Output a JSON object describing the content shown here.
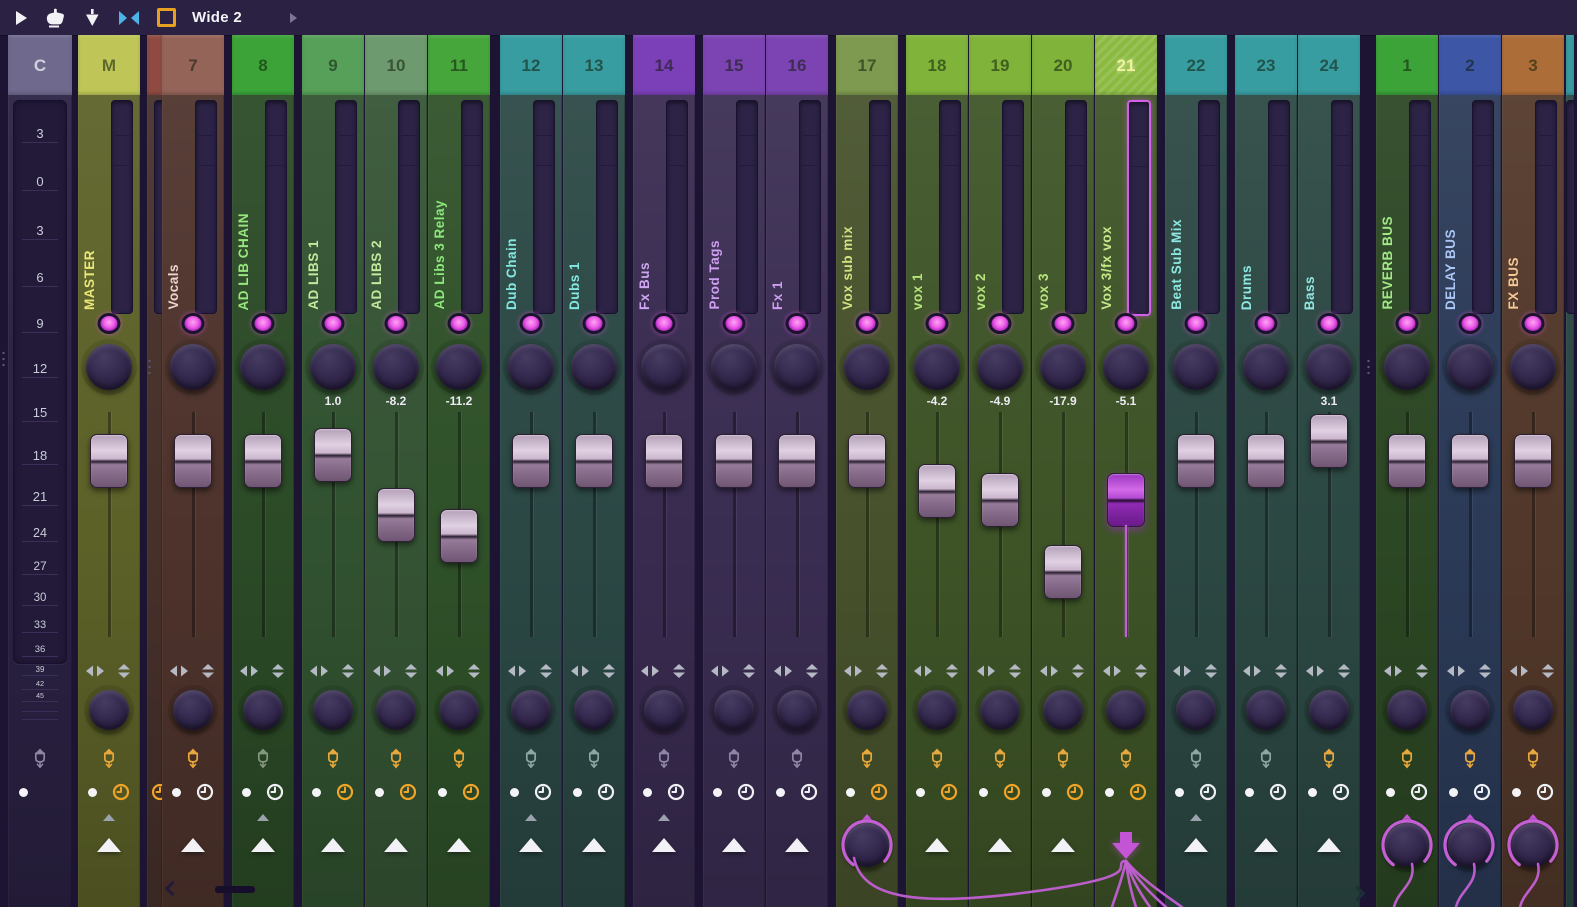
{
  "topbar": {
    "layout_label": "Wide 2",
    "icons": [
      "play-arrow-icon",
      "hand-cursor-icon",
      "plumb-bob-icon",
      "mirror-triangles-icon",
      "orange-square-icon",
      "chevron-right-icon"
    ],
    "accent_orange": "#e8a020",
    "accent_blue": "#4db4e8"
  },
  "scale_strip": {
    "header": "C",
    "labels": [
      "3",
      "0",
      "3",
      "6",
      "9",
      "12",
      "15",
      "18",
      "21",
      "24",
      "27",
      "30",
      "33",
      "36",
      "39",
      "42",
      "45"
    ],
    "lamp_color": "#8d87a4",
    "record_dot": true,
    "header_color": "#6f6a8d",
    "body_color": "#2a2142"
  },
  "colors": {
    "led": "#ea5ae6",
    "cable": "#c45fd6",
    "clock_orange": "#f0a428",
    "clock_white": "#eef0f4",
    "lamp_orange": "#e9a83c",
    "selected_outline": "#d45fe8"
  },
  "selection": {
    "selected_strip": "21"
  },
  "strips": [
    {
      "type": "strip",
      "number": "M",
      "name": "MASTER",
      "db": "",
      "fader": 0.13,
      "header": "#bfc657",
      "body": "#5c6128",
      "name_color": "#e9e977",
      "lamp": "#e9a83c",
      "clock": "#f0a428",
      "small_arrow": "#9aa2ad",
      "bottom": "triangle",
      "selected": false
    },
    {
      "type": "sliver",
      "number": "",
      "name": "",
      "header": "#8f4b41",
      "body": "#46302a",
      "clock": "#f0a428"
    },
    {
      "type": "strip",
      "number": "7",
      "name": "Vocals",
      "db": "",
      "fader": 0.13,
      "header": "#956459",
      "body": "#4e332c",
      "name_color": "#ecd3cb",
      "lamp": "#e9a83c",
      "clock": "#eef0f4",
      "small_arrow": null,
      "bottom": "triangle",
      "selected": false
    },
    {
      "type": "strip",
      "number": "8",
      "name": "AD LIB CHAIN",
      "db": "",
      "fader": 0.13,
      "header": "#3ba338",
      "body": "#2b4a26",
      "name_color": "#97e67e",
      "lamp": "#84977f",
      "clock": "#eef0f4",
      "small_arrow": "#9aa2ad",
      "bottom": "triangle",
      "selected": false
    },
    {
      "type": "strip",
      "number": "9",
      "name": "AD LIBS 1",
      "db": "1.0",
      "fader": 0.09,
      "header": "#57a059",
      "body": "#315230",
      "name_color": "#c4e89e",
      "lamp": "#e9a83c",
      "clock": "#f0a428",
      "small_arrow": null,
      "bottom": "triangle",
      "selected": false
    },
    {
      "type": "strip",
      "number": "10",
      "name": "AD LIBS 2",
      "db": "-8.2",
      "fader": 0.44,
      "header": "#6d9a6e",
      "body": "#355434",
      "name_color": "#c4e89e",
      "lamp": "#e9a83c",
      "clock": "#f0a428",
      "small_arrow": null,
      "bottom": "triangle",
      "selected": false
    },
    {
      "type": "strip",
      "number": "11",
      "name": "AD Libs 3 Relay",
      "db": "-11.2",
      "fader": 0.56,
      "header": "#46a63c",
      "body": "#2f5129",
      "name_color": "#8ce87a",
      "lamp": "#e9a83c",
      "clock": "#f0a428",
      "small_arrow": null,
      "bottom": "triangle",
      "selected": false
    },
    {
      "type": "strip",
      "number": "12",
      "name": "Dub Chain",
      "db": "",
      "fader": 0.13,
      "header": "#389da1",
      "body": "#2b4845",
      "name_color": "#83e8df",
      "lamp": "#8fa7a4",
      "clock": "#eef0f4",
      "small_arrow": "#9aa2ad",
      "bottom": "triangle",
      "selected": false
    },
    {
      "type": "strip",
      "number": "13",
      "name": "Dubs 1",
      "db": "",
      "fader": 0.13,
      "header": "#389da1",
      "body": "#2b4845",
      "name_color": "#83e8df",
      "lamp": "#8fa7a4",
      "clock": "#eef0f4",
      "small_arrow": null,
      "bottom": "triangle",
      "selected": false
    },
    {
      "type": "strip",
      "number": "14",
      "name": "Fx Bus",
      "db": "",
      "fader": 0.13,
      "header": "#7b3fb8",
      "body": "#392b50",
      "name_color": "#cda6f2",
      "lamp": "#8f86a8",
      "clock": "#eef0f4",
      "small_arrow": "#9aa2ad",
      "bottom": "triangle",
      "selected": false
    },
    {
      "type": "strip",
      "number": "15",
      "name": "Prod Tags",
      "db": "",
      "fader": 0.13,
      "header": "#7b44b2",
      "body": "#3a2d52",
      "name_color": "#cf9ef0",
      "lamp": "#8f86a8",
      "clock": "#eef0f4",
      "small_arrow": null,
      "bottom": "triangle",
      "selected": false
    },
    {
      "type": "strip",
      "number": "16",
      "name": "Fx 1",
      "db": "",
      "fader": 0.13,
      "header": "#7b44b2",
      "body": "#3a2d52",
      "name_color": "#cf9ef0",
      "lamp": "#8f86a8",
      "clock": "#eef0f4",
      "small_arrow": null,
      "bottom": "triangle",
      "selected": false
    },
    {
      "type": "strip",
      "number": "17",
      "name": "Vox sub mix",
      "db": "",
      "fader": 0.13,
      "header": "#7e9a50",
      "body": "#47522c",
      "name_color": "#cfe381",
      "lamp": "#e9a83c",
      "clock": "#f0a428",
      "small_arrow": "#c355d6",
      "bottom": "send-knob",
      "selected": false
    },
    {
      "type": "strip",
      "number": "18",
      "name": "vox 1",
      "db": "-4.2",
      "fader": 0.3,
      "header": "#7fb33a",
      "body": "#3e5427",
      "name_color": "#b6e47c",
      "lamp": "#e9a83c",
      "clock": "#f0a428",
      "small_arrow": null,
      "bottom": "triangle",
      "selected": false
    },
    {
      "type": "strip",
      "number": "19",
      "name": "vox 2",
      "db": "-4.9",
      "fader": 0.35,
      "header": "#7fb33a",
      "body": "#3e5427",
      "name_color": "#b6e47c",
      "lamp": "#e9a83c",
      "clock": "#f0a428",
      "small_arrow": null,
      "bottom": "triangle",
      "selected": false
    },
    {
      "type": "strip",
      "number": "20",
      "name": "vox 3",
      "db": "-17.9",
      "fader": 0.77,
      "header": "#7fb33a",
      "body": "#3e5427",
      "name_color": "#b6e47c",
      "lamp": "#e9a83c",
      "clock": "#f0a428",
      "small_arrow": null,
      "bottom": "triangle",
      "selected": false
    },
    {
      "type": "strip",
      "number": "21",
      "name": "Vox 3/fx vox",
      "db": "-5.1",
      "fader": 0.35,
      "header": "#8aba40",
      "body": "#3e5427",
      "name_color": "#c6e88a",
      "lamp": "#e9a83c",
      "clock": "#f0a428",
      "small_arrow": null,
      "bottom": "down-arrow",
      "selected": true
    },
    {
      "type": "strip",
      "number": "22",
      "name": "Beat Sub Mix",
      "db": "",
      "fader": 0.13,
      "header": "#389da1",
      "body": "#2c4843",
      "name_color": "#8fe8e0",
      "lamp": "#8fa7a4",
      "clock": "#eef0f4",
      "small_arrow": "#9aa2ad",
      "bottom": "triangle",
      "selected": false
    },
    {
      "type": "strip",
      "number": "23",
      "name": "Drums",
      "db": "",
      "fader": 0.13,
      "header": "#389da1",
      "body": "#2c4843",
      "name_color": "#8fe8e0",
      "lamp": "#8fa7a4",
      "clock": "#eef0f4",
      "small_arrow": null,
      "bottom": "triangle",
      "selected": false
    },
    {
      "type": "strip",
      "number": "24",
      "name": "Bass",
      "db": "3.1",
      "fader": 0.01,
      "header": "#389da1",
      "body": "#2c4843",
      "name_color": "#8fe8e0",
      "lamp": "#e9a83c",
      "clock": "#eef0f4",
      "small_arrow": null,
      "bottom": "triangle",
      "selected": false
    },
    {
      "type": "strip",
      "number": "1",
      "name": "REVERB BUS",
      "db": "",
      "fader": 0.13,
      "header": "#3ba338",
      "body": "#2c4724",
      "name_color": "#a3e886",
      "lamp": "#e9a83c",
      "clock": "#eef0f4",
      "small_arrow": "#c355d6",
      "bottom": "send-knob",
      "selected": false
    },
    {
      "type": "strip",
      "number": "2",
      "name": "DELAY BUS",
      "db": "",
      "fader": 0.13,
      "header": "#3d56a6",
      "body": "#2b3a57",
      "name_color": "#acc6f6",
      "lamp": "#e9a83c",
      "clock": "#eef0f4",
      "small_arrow": "#c355d6",
      "bottom": "send-knob",
      "selected": false
    },
    {
      "type": "strip",
      "number": "3",
      "name": "FX BUS",
      "db": "",
      "fader": 0.13,
      "header": "#ad6d38",
      "body": "#52382a",
      "name_color": "#f4c795",
      "lamp": "#e9a83c",
      "clock": "#eef0f4",
      "small_arrow": "#c355d6",
      "bottom": "send-knob",
      "selected": false
    },
    {
      "type": "sliver",
      "number": "",
      "name": "",
      "header": "#379ca0",
      "body": "#2b4743",
      "clock": null
    }
  ]
}
